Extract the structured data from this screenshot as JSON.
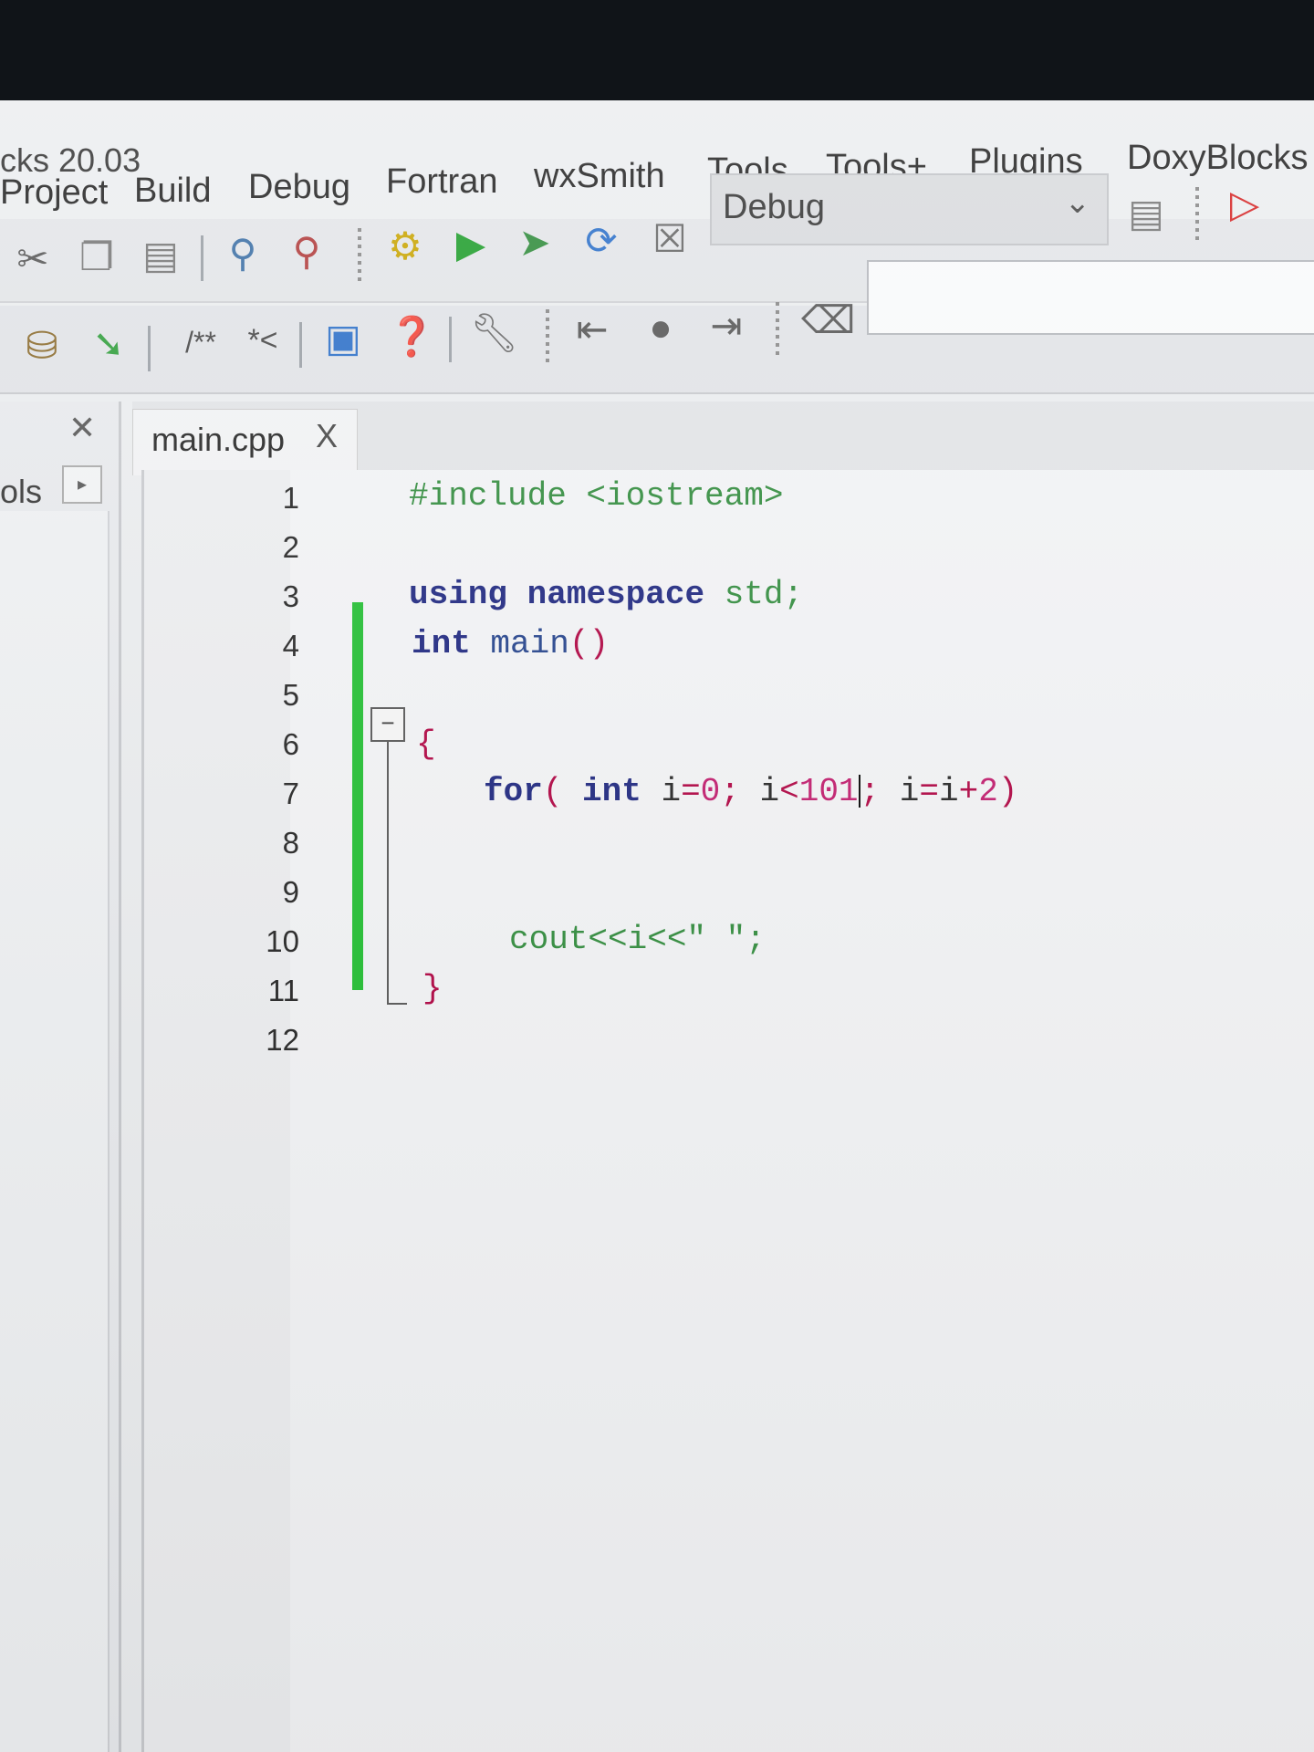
{
  "window": {
    "title": "cks 20.03"
  },
  "menu": [
    "Project",
    "Build",
    "Debug",
    "Fortran",
    "wxSmith",
    "Tools",
    "Tools+",
    "Plugins",
    "DoxyBlocks"
  ],
  "toolbar": {
    "build_target": "Debug",
    "doxy_comment_block": "/**",
    "doxy_line_comment": "*<"
  },
  "left_panel": {
    "label": "ols"
  },
  "tabs": [
    {
      "label": "main.cpp",
      "close": "X"
    }
  ],
  "editor": {
    "line_numbers": [
      "1",
      "2",
      "3",
      "4",
      "5",
      "6",
      "7",
      "8",
      "9",
      "10",
      "11",
      "12"
    ],
    "lines": {
      "l1": "#include <iostream>",
      "l3_kw1": "using",
      "l3_kw2": "namespace",
      "l3_rest": "std;",
      "l4_kw": "int",
      "l4_rest": "main",
      "l4_paren": "()",
      "l6": "{",
      "l7_for": "for",
      "l7_paren": "(",
      "l7_int": "int",
      "l7_i": "i",
      "l7_eq": "=",
      "l7_zero": "0",
      "l7_semi1": ";",
      "l7_i2": "i",
      "l7_lt": "<",
      "l7_num": "101",
      "l7_semi2": ";",
      "l7_i3": "i",
      "l7_eq2": "=",
      "l7_i4": "i",
      "l7_plus": "+",
      "l7_two": "2",
      "l7_close": ")",
      "l10": "cout<<i<<\" \";",
      "l11": "}"
    }
  },
  "colors": {
    "change_marker": "#1fbf2f",
    "keyword": "#1a237e",
    "preprocessor": "#2e8b3a",
    "number": "#c2186b"
  }
}
